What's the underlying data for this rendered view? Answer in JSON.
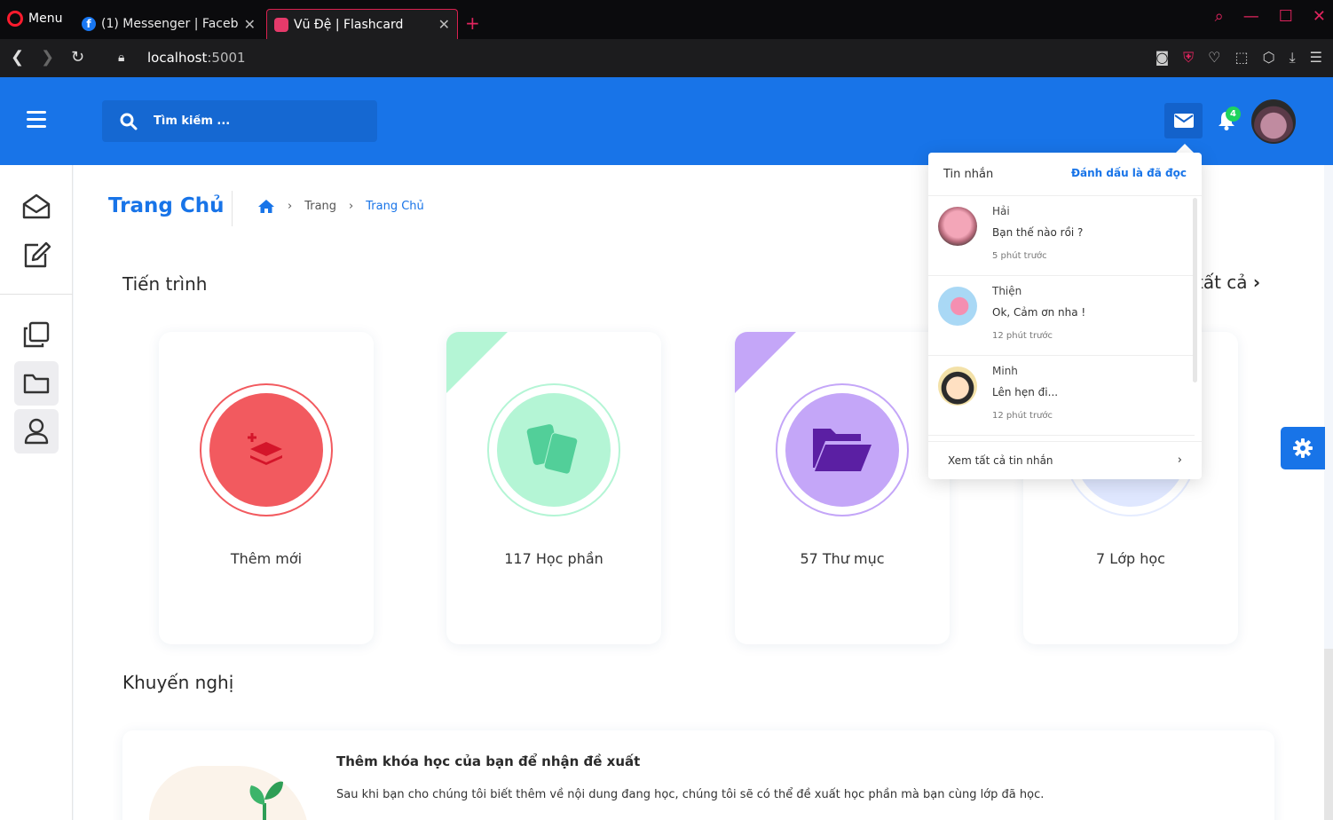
{
  "browser": {
    "menu_label": "Menu",
    "tabs": [
      {
        "title": "(1) Messenger | Facebook",
        "favicon": "f"
      },
      {
        "title": "Vũ Đệ | Flashcard"
      }
    ],
    "url_host": "localhost",
    "url_port": ":5001"
  },
  "header": {
    "search_placeholder": "Tìm kiếm ...",
    "notification_count": "4"
  },
  "page": {
    "title": "Trang Chủ",
    "breadcrumb": [
      "Trang",
      "Trang Chủ"
    ]
  },
  "progress": {
    "title": "Tiến trình",
    "see_all": "tất cả",
    "cards": [
      {
        "label": "Thêm mới",
        "color": "#f25a5f"
      },
      {
        "label": "117 Học phần",
        "color": "#52cf99"
      },
      {
        "label": "57 Thư mục",
        "color": "#c4a6f8"
      },
      {
        "label": "7 Lớp học",
        "color": "#dfe7ff"
      }
    ]
  },
  "recommend": {
    "title": "Khuyến nghị",
    "card_heading": "Thêm khóa học của bạn để nhận đề xuất",
    "card_text": "Sau khi bạn cho chúng tôi biết thêm về nội dung đang học, chúng tôi sẽ có thể đề xuất học phần mà bạn cùng lớp đã học."
  },
  "messages": {
    "title": "Tin nhắn",
    "mark_read": "Đánh dấu là đã đọc",
    "items": [
      {
        "name": "Hải",
        "text": "Bạn thế nào rồi ?",
        "time": "5 phút trước"
      },
      {
        "name": "Thiện",
        "text": "Ok, Cảm ơn nha !",
        "time": "12 phút trước"
      },
      {
        "name": "Minh",
        "text": "Lên hẹn đi...",
        "time": "12 phút trước"
      }
    ],
    "see_all": "Xem tất cả tin nhắn"
  },
  "colors": {
    "brand": "#1874e8",
    "badge": "#1ed35e"
  }
}
